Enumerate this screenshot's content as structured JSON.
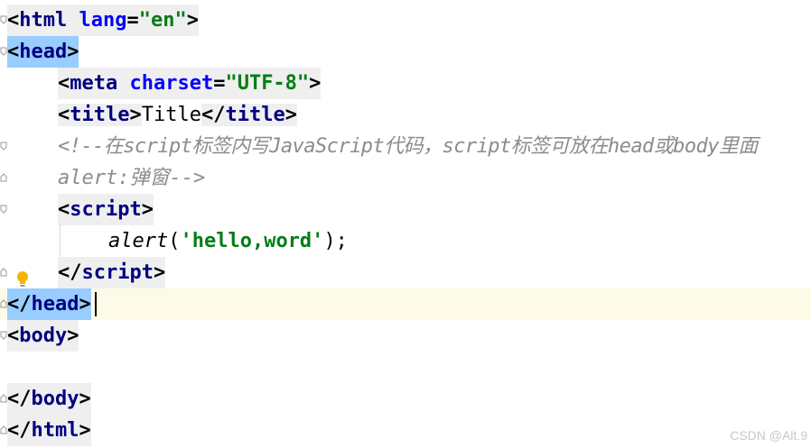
{
  "editor": {
    "lines": {
      "html_open": {
        "lt": "<",
        "tag": "html",
        "attr": "lang",
        "eq": "=",
        "val": "\"en\"",
        "gt": ">"
      },
      "head_open": {
        "lt": "<",
        "tag": "head",
        "gt": ">"
      },
      "meta": {
        "lt": "<",
        "tag": "meta",
        "attr": "charset",
        "eq": "=",
        "val": "\"UTF-8\"",
        "gt": ">"
      },
      "title": {
        "lt1": "<",
        "tag1": "title",
        "gt1": ">",
        "text": "Title",
        "lt2": "</",
        "tag2": "title",
        "gt2": ">"
      },
      "comment1": "<!--在script标签内写JavaScript代码，script标签可放在head或body里面",
      "comment2": "alert:弹窗-->",
      "script_open": {
        "lt": "<",
        "tag": "script",
        "gt": ">"
      },
      "alert": {
        "fn": "alert",
        "open": "(",
        "str": "'hello,word'",
        "close": ");"
      },
      "script_close": {
        "lt": "</",
        "tag": "script",
        "gt": ">"
      },
      "head_close": {
        "lt": "</",
        "tag": "head",
        "gt": ">"
      },
      "body_open": {
        "lt": "<",
        "tag": "body",
        "gt": ">"
      },
      "body_close": {
        "lt": "</",
        "tag": "body",
        "gt": ">"
      },
      "html_close": {
        "lt": "</",
        "tag": "html",
        "gt": ">"
      }
    }
  },
  "watermark": "CSDN @Alt.9",
  "colors": {
    "tag": "#000080",
    "attribute": "#0000ff",
    "string": "#067d17",
    "comment": "#8c8c8c",
    "tag_bg": "#efefef",
    "tag_match_bg": "#99ccff",
    "current_line": "#fefae8"
  },
  "icons": [
    "fold-icon",
    "intention-bulb-icon"
  ]
}
